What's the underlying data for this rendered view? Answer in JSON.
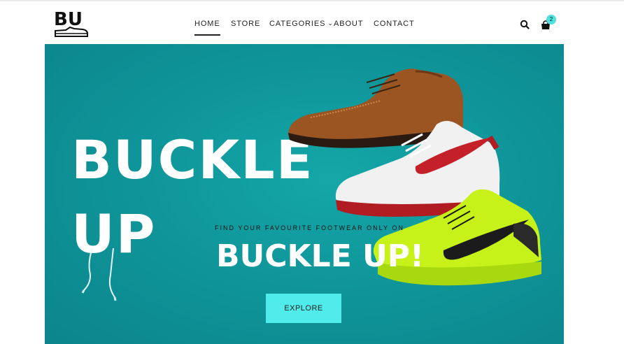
{
  "brand": {
    "logo_text": "BU"
  },
  "nav": {
    "items": [
      {
        "label": "HOME"
      },
      {
        "label": "STORE"
      },
      {
        "label": "CATEGORIES"
      },
      {
        "label": "ABOUT"
      },
      {
        "label": "CONTACT"
      }
    ],
    "active_index": 0
  },
  "header_icons": {
    "search": "search-icon",
    "cart": "shopping-bag-icon",
    "cart_count": "2"
  },
  "hero": {
    "title_line1": "BUCKLE",
    "title_line2": "UP",
    "tagline": "FIND YOUR FAVOURITE FOOTWEAR ONLY ON",
    "headline": "BUCKLE UP!",
    "cta_label": "EXPLORE"
  },
  "colors": {
    "hero_bg": "#0f969a",
    "cta_bg": "#50ebeb",
    "badge_bg": "#4ee1df",
    "text_dark": "#222222"
  }
}
